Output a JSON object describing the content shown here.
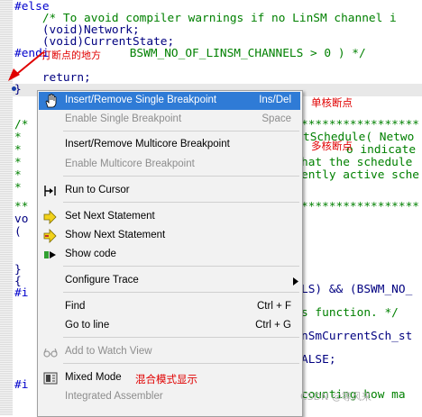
{
  "code": {
    "l1": "#else",
    "l2": "    /* To avoid compiler warnings if no LinSM channel i",
    "l3": "    (void)Network;",
    "l4": "    (void)CurrentState;",
    "l5_pre": "#endi",
    "l5_post": " BSWM_NO_OF_LINSM_CHANNELS > 0 ) */",
    "l6": "    return;",
    "l7": "}",
    "r1": "tSchedule( Netwo",
    "r2": "o indicate the",
    "r3": "hat the schedule",
    "r4": "ently active sche",
    "r5": "LS) && (BSWM_NO_",
    "r6": "s function. */",
    "r7": "nSmCurrentSch_st",
    "r8": "ALSE;",
    "r9": "counting how ma",
    "left_frag": [
      "/*",
      "*",
      "*",
      "*",
      "*",
      "*",
      "**",
      "vo",
      "(",
      "",
      "}",
      "{",
      "#i",
      "",
      "",
      "",
      "",
      "",
      "#i"
    ]
  },
  "annotations": {
    "break_point_label": "打断点的地方",
    "single_core": "单核断点",
    "multi_core": "多核断点",
    "mixed_mode": "混合模式显示"
  },
  "context_menu": {
    "items": [
      {
        "label": "Insert/Remove Single Breakpoint",
        "shortcut": "Ins/Del",
        "icon": "hand-icon",
        "selected": true
      },
      {
        "label": "Enable Single Breakpoint",
        "shortcut": "Space",
        "disabled": true
      },
      {
        "label": "Insert/Remove Multicore Breakpoint"
      },
      {
        "label": "Enable Multicore Breakpoint",
        "disabled": true
      },
      {
        "label": "Run to Cursor",
        "icon": "run-to-cursor-icon"
      },
      {
        "label": "Set Next Statement",
        "icon": "set-next-statement-icon"
      },
      {
        "label": "Show Next Statement",
        "icon": "show-next-statement-icon"
      },
      {
        "label": "Show code",
        "icon": "show-code-icon"
      },
      {
        "label": "Configure Trace",
        "submenu": true
      },
      {
        "label": "Find",
        "shortcut": "Ctrl + F"
      },
      {
        "label": "Go to line",
        "shortcut": "Ctrl + G"
      },
      {
        "label": "Add to Watch View",
        "disabled": true,
        "icon": "glasses-icon"
      },
      {
        "label": "Mixed Mode",
        "icon": "mixed-mode-icon"
      },
      {
        "label": "Integrated Assembler",
        "disabled": true
      }
    ]
  },
  "watermark": "CSDN @等风来",
  "colors": {
    "selection": "#2f7bd6",
    "annotation": "#e00000",
    "comment": "#008000",
    "keyword": "#0000cc"
  }
}
